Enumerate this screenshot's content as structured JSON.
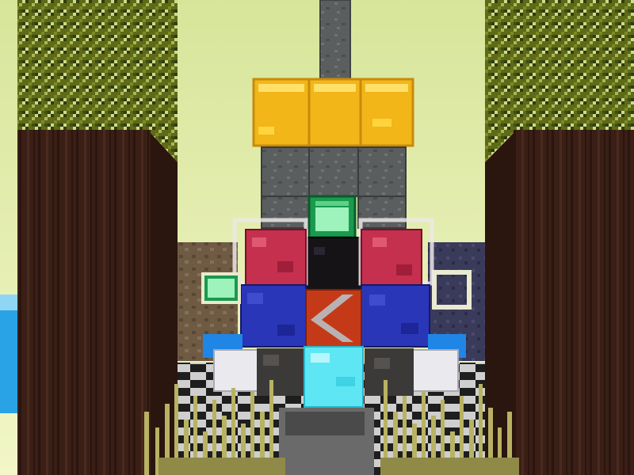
{
  "scene": {
    "description_type": "voxel-game-viewport",
    "colors": {
      "sky": "#dde9a6",
      "sky_horizon": "#f2f6c8",
      "leaves": "#5e6a17",
      "leaves_dark": "#2f3d0e",
      "leaves_light": "#a8b75a",
      "oak_log": "#3a1f16",
      "oak_log_stripe": "#2a150f",
      "gold_block": "#f2b619",
      "gold_highlight": "#ffe16a",
      "stone_brick": "#5a5e5e",
      "emerald": "#1a9a4e",
      "redstone_block": "#c4304e",
      "lapis_block": "#2a36b8",
      "obsidian": "#151316",
      "red_chevron": "#c43a18",
      "chevron_arrow": "#b9b2b2",
      "diamond_block": "#5fe6f4",
      "quartz": "#e9e9ee",
      "dirt_wall": "#6f5b43",
      "purple_wall": "#3a3a5a",
      "water": "#2aa2e6",
      "grass_tuft": "#b8b263",
      "glass_frame": "#e9ead0"
    }
  }
}
